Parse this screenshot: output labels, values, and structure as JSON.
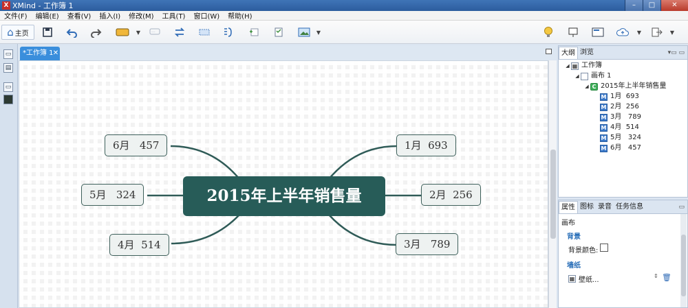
{
  "window": {
    "title": "XMind - 工作簿 1",
    "app_icon_letter": "X",
    "minimize": "–",
    "maximize": "□",
    "close": "✕"
  },
  "menu": [
    "文件(F)",
    "编辑(E)",
    "查看(V)",
    "插入(I)",
    "修改(M)",
    "工具(T)",
    "窗口(W)",
    "帮助(H)"
  ],
  "toolbar": {
    "home_label": "主页",
    "icons": [
      "home-icon",
      "save-icon",
      "undo-icon",
      "redo-icon",
      "insert-topic-icon",
      "callout-icon",
      "relationship-icon",
      "boundary-icon",
      "summary-icon",
      "note-icon",
      "task-icon",
      "image-icon",
      "idea-icon",
      "presentation-icon",
      "overview-icon",
      "share-icon",
      "export-icon"
    ]
  },
  "editor": {
    "tab_label": "*工作簿 1",
    "tab_close": "✕"
  },
  "mindmap": {
    "central": "2015年上半年销售量",
    "branch_color": "#2f5b57",
    "central_color": "#275c58",
    "topics": [
      {
        "label": "1月  693"
      },
      {
        "label": "2月  256"
      },
      {
        "label": "3月   789"
      },
      {
        "label": "4月  514"
      },
      {
        "label": "5月   324"
      },
      {
        "label": "6月   457"
      }
    ]
  },
  "outline_panel": {
    "tabs": [
      "大纲",
      "浏览"
    ],
    "active_tab": "大纲",
    "tree": {
      "workbook": "工作簿",
      "sheet": "画布 1",
      "central": "2015年上半年销售量",
      "items": [
        "1月  693",
        "2月  256",
        "3月   789",
        "4月  514",
        "5月   324",
        "6月   457"
      ]
    }
  },
  "properties_panel": {
    "tabs": [
      "属性",
      "图标",
      "录音",
      "任务信息"
    ],
    "active_tab": "属性",
    "heading": "画布",
    "background_section": "背景",
    "background_color_label": "背景颜色:",
    "wallpaper_section": "墙纸",
    "wallpaper_value": "壁纸..."
  }
}
